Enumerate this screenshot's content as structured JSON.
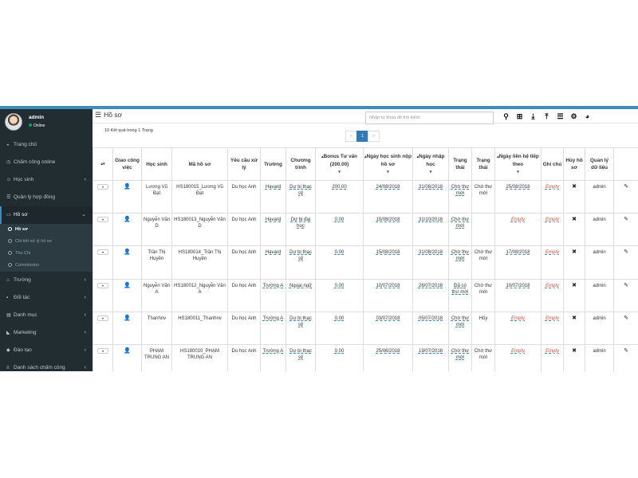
{
  "user": {
    "name": "admin",
    "status": "Online"
  },
  "nav": {
    "items": [
      {
        "label": "Trang chủ",
        "icon": "dashboard-icon",
        "glyph": "◒",
        "chev": ""
      },
      {
        "label": "Chấm công online",
        "icon": "clock-icon",
        "glyph": "◷",
        "chev": ""
      },
      {
        "label": "Học sinh",
        "icon": "users-icon",
        "glyph": "☺",
        "chev": "‹"
      },
      {
        "label": "Quản lý hợp đồng",
        "icon": "contract-icon",
        "glyph": "☰",
        "chev": ""
      },
      {
        "label": "Hồ sơ",
        "icon": "folder-icon",
        "glyph": "▭",
        "chev": "⌄"
      }
    ],
    "sub_items": [
      "Hồ sơ",
      "Chi tiết xử lý hồ sơ",
      "Thu Chi",
      "Commission"
    ],
    "items2": [
      {
        "label": "Trường",
        "icon": "school-icon",
        "glyph": "⌂",
        "chev": "‹"
      },
      {
        "label": "Đối tác",
        "icon": "partner-icon",
        "glyph": "▪",
        "chev": "‹"
      },
      {
        "label": "Danh mục",
        "icon": "list-icon",
        "glyph": "▤",
        "chev": "‹"
      },
      {
        "label": "Marketing",
        "icon": "megaphone-icon",
        "glyph": "◣",
        "chev": "‹"
      },
      {
        "label": "Đào tạo",
        "icon": "graduation-icon",
        "glyph": "◆",
        "chev": "‹"
      },
      {
        "label": "Danh sách chấm công",
        "icon": "list-icon",
        "glyph": "≡",
        "chev": "‹"
      }
    ]
  },
  "page": {
    "title": "Hồ sơ",
    "results": "10 Kết quả trong 1 Trang"
  },
  "search": {
    "placeholder": "Nhập từ khóa để tìm kiếm"
  },
  "toolbar": [
    {
      "name": "search-icon",
      "glyph": "⚲"
    },
    {
      "name": "add-icon",
      "glyph": "⊞"
    },
    {
      "name": "download-icon",
      "glyph": "⤓"
    },
    {
      "name": "upload-icon",
      "glyph": "⤒"
    },
    {
      "name": "columns-icon",
      "glyph": "☰"
    },
    {
      "name": "settings-icon",
      "glyph": "⚙"
    },
    {
      "name": "chart-icon",
      "glyph": "◕"
    }
  ],
  "pager": {
    "prev": "«",
    "current": "1",
    "next": "»"
  },
  "table": {
    "headers": [
      "",
      "Giao công việc",
      "Học sinh",
      "Mã hồ sơ",
      "Yêu cầu xử lý",
      "Trường",
      "Chương trình",
      "Bonus Tư vấn (200.00)",
      "Ngày học sinh nộp hồ sơ",
      "Ngày nhập học",
      "Trạng thái",
      "Trạng thái",
      "Ngày liên hệ tiếp theo",
      "Ghi chú",
      "Hủy hồ sơ",
      "Quản lý dữ liệu",
      ""
    ],
    "rows": [
      {
        "name": "Lương Vũ Đạt",
        "code": "HS180015_Lương Vũ Đạt",
        "req": "Du học Anh",
        "school": "Havard",
        "program": "Dự bị thạc sỹ",
        "bonus": "200.00",
        "submit": "24/08/2018",
        "enroll": "31/08/2018",
        "status1": "Chờ thư mời",
        "status2": "Chờ thư mời",
        "next": "25/08/2018",
        "note": "Empty",
        "manager": "admin"
      },
      {
        "name": "Nguyễn Văn D",
        "code": "HS180013_Nguyễn Văn D",
        "req": "Du học Anh",
        "school": "Havard",
        "program": "Dự bị đại học",
        "bonus": "0.00",
        "submit": "15/08/2018",
        "enroll": "31/10/2018",
        "status1": "Chờ thư mời",
        "status2": "",
        "next": "Empty",
        "note": "Empty",
        "manager": "admin"
      },
      {
        "name": "Trần Thị Huyền",
        "code": "HS180014_Trần Thị Huyền",
        "req": "Du học Anh",
        "school": "Havard",
        "program": "Dự bị thạc sỹ",
        "bonus": "0.00",
        "submit": "15/08/2018",
        "enroll": "31/08/2018",
        "status1": "Chờ thư mời",
        "status2": "Chờ thư mời",
        "next": "17/08/2018",
        "note": "Empty",
        "manager": "admin"
      },
      {
        "name": "Nguyễn Văn A",
        "code": "HS180012_Nguyễn Văn A",
        "req": "Du học Anh",
        "school": "Trường A",
        "program": "Ngoại ngữ",
        "bonus": "0.00",
        "submit": "10/07/2018",
        "enroll": "26/07/2018",
        "status1": "Đã có thư mời",
        "status2": "Chờ thư mời",
        "next": "10/07/2018",
        "note": "Empty",
        "manager": "admin"
      },
      {
        "name": "Thanhnv",
        "code": "HS180011_Thanhnv",
        "req": "Du học Anh",
        "school": "Trường A",
        "program": "Dự bị thạc sỹ",
        "bonus": "0.00",
        "submit": "03/07/2018",
        "enroll": "05/07/2018",
        "status1": "Chờ thư mời",
        "status2": "Hủy",
        "next": "Empty",
        "note": "Empty",
        "manager": "admin"
      },
      {
        "name": "PHẠM TRUNG AN",
        "code": "HS180010_PHẠM TRUNG AN",
        "req": "Du học Anh",
        "school": "Trường A",
        "program": "Dự bị thạc sỹ",
        "bonus": "0.00",
        "submit": "25/06/2018",
        "enroll": "19/07/2018",
        "status1": "Chờ thư mời",
        "status2": "Chờ thư mời",
        "next": "Empty",
        "note": "Empty",
        "manager": "admin"
      }
    ]
  },
  "colors": {
    "accent": "#3c8dbc",
    "sidebar": "#222d32",
    "empty": "#dd4b39"
  }
}
